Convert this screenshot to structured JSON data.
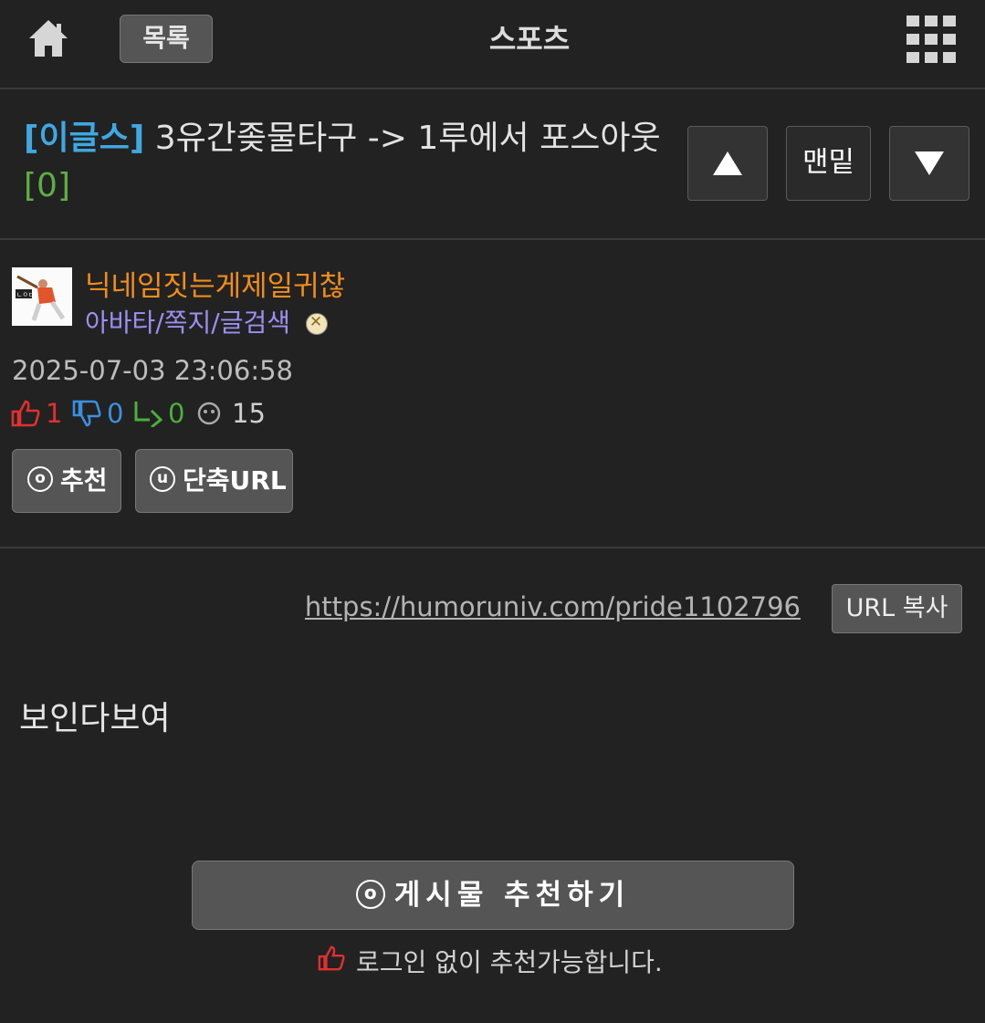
{
  "header": {
    "list_label": "목록",
    "title": "스포츠",
    "home_icon": "home-icon",
    "menu_icon": "grid-menu-icon"
  },
  "post": {
    "board_tag": "[이글스]",
    "title": "3유간좆물타구 -> 1루에서 포스아웃",
    "comment_count": "[0]",
    "nav": {
      "up_icon": "arrow-up-icon",
      "bottom_label": "맨밑",
      "down_icon": "arrow-down-icon"
    },
    "author": {
      "nickname": "닉네임짓는게제일귀찮",
      "links": [
        "아바타",
        "쪽지",
        "글검색"
      ],
      "separator": "/"
    },
    "date": "2025-07-03 23:06:58",
    "stats": {
      "likes": "1",
      "dislikes": "0",
      "shares": "0",
      "views": "15"
    },
    "buttons": {
      "recommend": "추천",
      "short_url": "단축URL",
      "recommend_circle": "o",
      "short_url_circle": "u"
    },
    "url": "https://humoruniv.com/pride1102796",
    "copy_label": "URL 복사",
    "body": "보인다보여",
    "big_recommend": "게시물 추천하기",
    "big_recommend_circle": "o",
    "login_note": "로그인 없이 추천가능합니다."
  },
  "colors": {
    "background": "#222222",
    "board_tag": "#3fa8e0",
    "comment_count": "#5fae44",
    "nickname": "#f08d1c",
    "member_links": "#9d8ff0",
    "like": "#e03030",
    "dislike": "#3a8fe0",
    "share": "#4cae3c"
  }
}
